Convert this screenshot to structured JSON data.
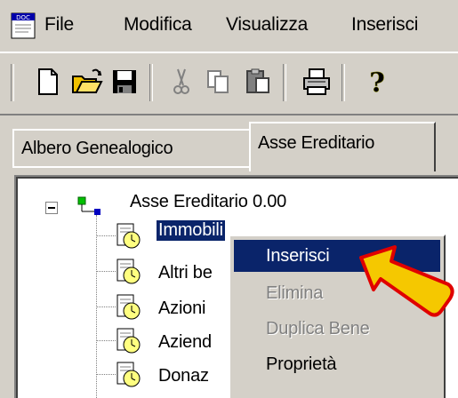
{
  "menubar": {
    "items": [
      {
        "label": "File"
      },
      {
        "label": "Modifica"
      },
      {
        "label": "Visualizza"
      },
      {
        "label": "Inserisci"
      }
    ],
    "app_icon_text": "DOC"
  },
  "toolbar": {
    "buttons": [
      {
        "icon": "new-document-icon"
      },
      {
        "icon": "open-folder-icon"
      },
      {
        "icon": "save-disk-icon"
      },
      {
        "icon": "cut-scissors-icon",
        "disabled": true
      },
      {
        "icon": "copy-icon",
        "disabled": true
      },
      {
        "icon": "paste-icon"
      },
      {
        "icon": "print-icon"
      },
      {
        "icon": "help-question-icon"
      }
    ]
  },
  "tabs": [
    {
      "label": "Albero Genealogico",
      "active": false
    },
    {
      "label": "Asse Ereditario",
      "active": true
    }
  ],
  "tree": {
    "root": {
      "label": "Asse Ereditario 0.00",
      "expanded": true
    },
    "children": [
      {
        "label": "Immobili",
        "selected": true
      },
      {
        "label": "Altri be"
      },
      {
        "label": "Azioni"
      },
      {
        "label": "Aziend"
      },
      {
        "label": "Donaz"
      }
    ]
  },
  "context_menu": {
    "items": [
      {
        "label": "Inserisci",
        "highlighted": true,
        "enabled": true
      },
      {
        "label": "Elimina",
        "enabled": false
      },
      {
        "label": "Duplica Bene",
        "enabled": false
      },
      {
        "label": "Proprietà",
        "enabled": true
      }
    ]
  },
  "colors": {
    "window_bg": "#d4d0c8",
    "selection_bg": "#0a246a",
    "arrow_fill": "#f5c800",
    "arrow_outline": "#e00000"
  }
}
